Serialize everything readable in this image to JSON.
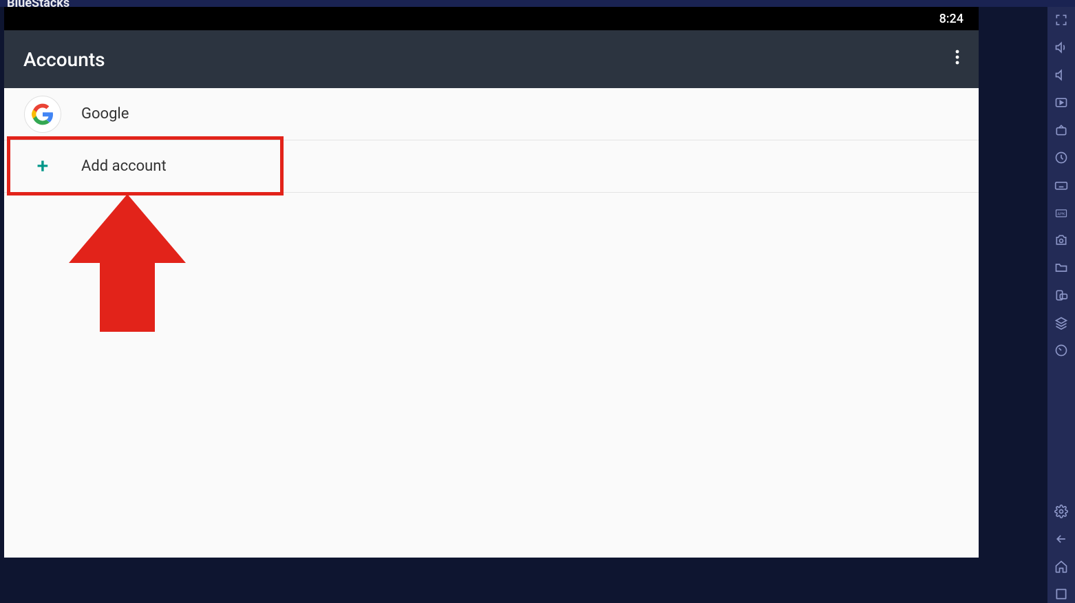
{
  "titlebar": {
    "brand": "BlueStacks"
  },
  "status": {
    "time": "8:24"
  },
  "appbar": {
    "title": "Accounts"
  },
  "rows": {
    "google": {
      "label": "Google"
    },
    "add": {
      "label": "Add account"
    }
  },
  "sidebar_icons": {
    "fullscreen": "fullscreen-icon",
    "volume_up": "volume-up-icon",
    "volume_down": "volume-down-icon",
    "play_file": "play-file-icon",
    "live": "live-icon",
    "clock": "recent-icon",
    "keyboard": "keyboard-icon",
    "apk": "apk-icon",
    "screenshot": "screenshot-icon",
    "folder": "folder-icon",
    "rotate": "rotate-icon",
    "layers": "layers-icon",
    "gauge": "gauge-icon",
    "settings": "settings-icon",
    "back": "back-icon",
    "home": "home-icon",
    "recents": "recents-icon"
  }
}
